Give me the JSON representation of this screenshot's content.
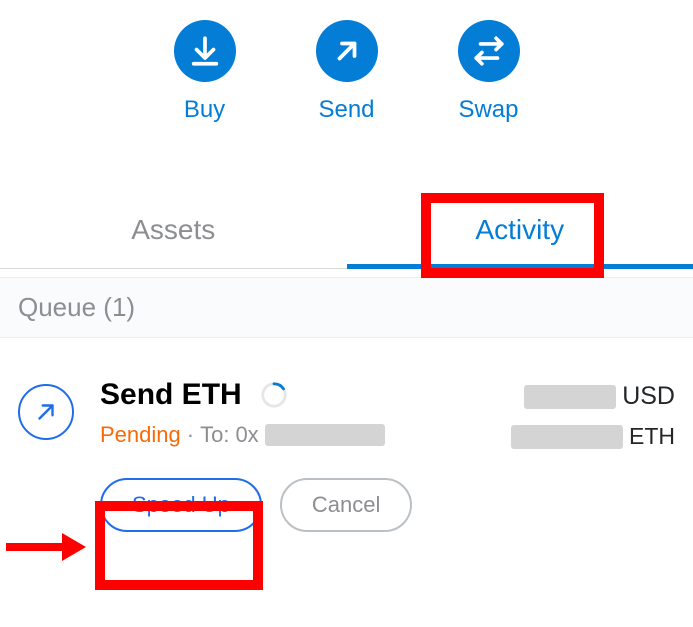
{
  "actions": {
    "buy": "Buy",
    "send": "Send",
    "swap": "Swap"
  },
  "tabs": {
    "assets": "Assets",
    "activity": "Activity"
  },
  "queue": {
    "label": "Queue (1)"
  },
  "tx": {
    "title": "Send ETH",
    "status": "Pending",
    "separator": "·",
    "to_label": "To:",
    "to_prefix": "0x",
    "fiat_currency": "USD",
    "asset_currency": "ETH"
  },
  "buttons": {
    "speed_up": "Speed Up",
    "cancel": "Cancel"
  },
  "colors": {
    "brand": "#037dd6",
    "warning": "#f66a0a"
  }
}
